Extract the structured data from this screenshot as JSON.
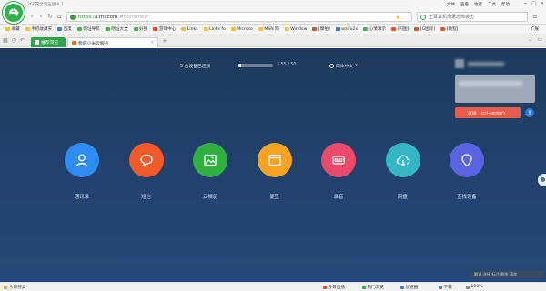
{
  "window": {
    "title": "360安全浏览器 8.1",
    "menu": [
      "文件",
      "查看",
      "收藏",
      "工具",
      "帮助"
    ],
    "controls": [
      "─",
      "□",
      "✕"
    ]
  },
  "address_bar": {
    "url_scheme": "https://",
    "url_host": "i.mi.com",
    "url_path": "/#homenew",
    "search_placeholder": "土耳其机场遭恐怖袭击"
  },
  "bookmarks": {
    "items": [
      {
        "label": "收藏",
        "color": "#f0c040"
      },
      {
        "label": "手机收藏夹",
        "color": "#f0c040"
      },
      {
        "label": "百度",
        "color": "#3b7ddd"
      },
      {
        "label": "网址导航",
        "color": "#4caf50"
      },
      {
        "label": "网址大全",
        "color": "#4caf50"
      },
      {
        "label": "好搜",
        "color": "#4caf50"
      },
      {
        "label": "游戏中心",
        "color": "#e04f2f"
      },
      {
        "label": "Links",
        "color": "#f0c040"
      },
      {
        "label": "Links fo",
        "color": "#f0c040"
      },
      {
        "label": "Microso",
        "color": "#f0c040"
      },
      {
        "label": "MSN 网",
        "color": "#f0c040"
      },
      {
        "label": "Window",
        "color": "#f0c040"
      },
      {
        "label": "[摩拍]",
        "color": "#e04f2f"
      },
      {
        "label": "waifu2x",
        "color": "#3b7ddd"
      },
      {
        "label": "心情演示",
        "color": "#4caf50"
      },
      {
        "label": "[闪图]",
        "color": "#e04f2f"
      },
      {
        "label": "[G图标]",
        "color": "#e04f2f"
      },
      {
        "label": "[教程]",
        "color": "#e04f2f"
      }
    ],
    "extension_label": "扩展"
  },
  "tabs": {
    "items": [
      {
        "label": "推荐浏览",
        "active": false
      },
      {
        "label": "我的小米云服务",
        "active": true
      }
    ],
    "add": "+"
  },
  "cloud": {
    "status_text": "5 台设备已连接",
    "storage_text": "3.55 / 50",
    "storage_used_fraction": 0.071,
    "language": "简体中文",
    "send_button": "发送（ctrl+enter）",
    "info_icon": "!",
    "apps": [
      {
        "label": "通讯录",
        "icon": "contact-icon",
        "color": "#2d8cf0"
      },
      {
        "label": "短信",
        "icon": "sms-icon",
        "color": "#f4592a"
      },
      {
        "label": "云相册",
        "icon": "gallery-icon",
        "color": "#2fb040"
      },
      {
        "label": "便签",
        "icon": "notes-icon",
        "color": "#f6a223"
      },
      {
        "label": "录音",
        "icon": "recorder-icon",
        "color": "#ec4a6a"
      },
      {
        "label": "网盘",
        "icon": "drive-icon",
        "color": "#33b7c6"
      },
      {
        "label": "查找设备",
        "icon": "find-device-icon",
        "color": "#5a63e0"
      }
    ],
    "overlay_text": "翻译 选择 标注 截图 清除"
  },
  "status_bar": {
    "left": "今日特卖",
    "items": [
      {
        "label": "今日直播",
        "color": "#e04f2f"
      },
      {
        "label": "热門浏览",
        "color": "#2fb040"
      },
      {
        "label": "加速器",
        "color": "#3b7ddd"
      },
      {
        "label": "下载",
        "color": "#3b7ddd"
      },
      {
        "label": "100%",
        "color": "#888888"
      }
    ]
  }
}
